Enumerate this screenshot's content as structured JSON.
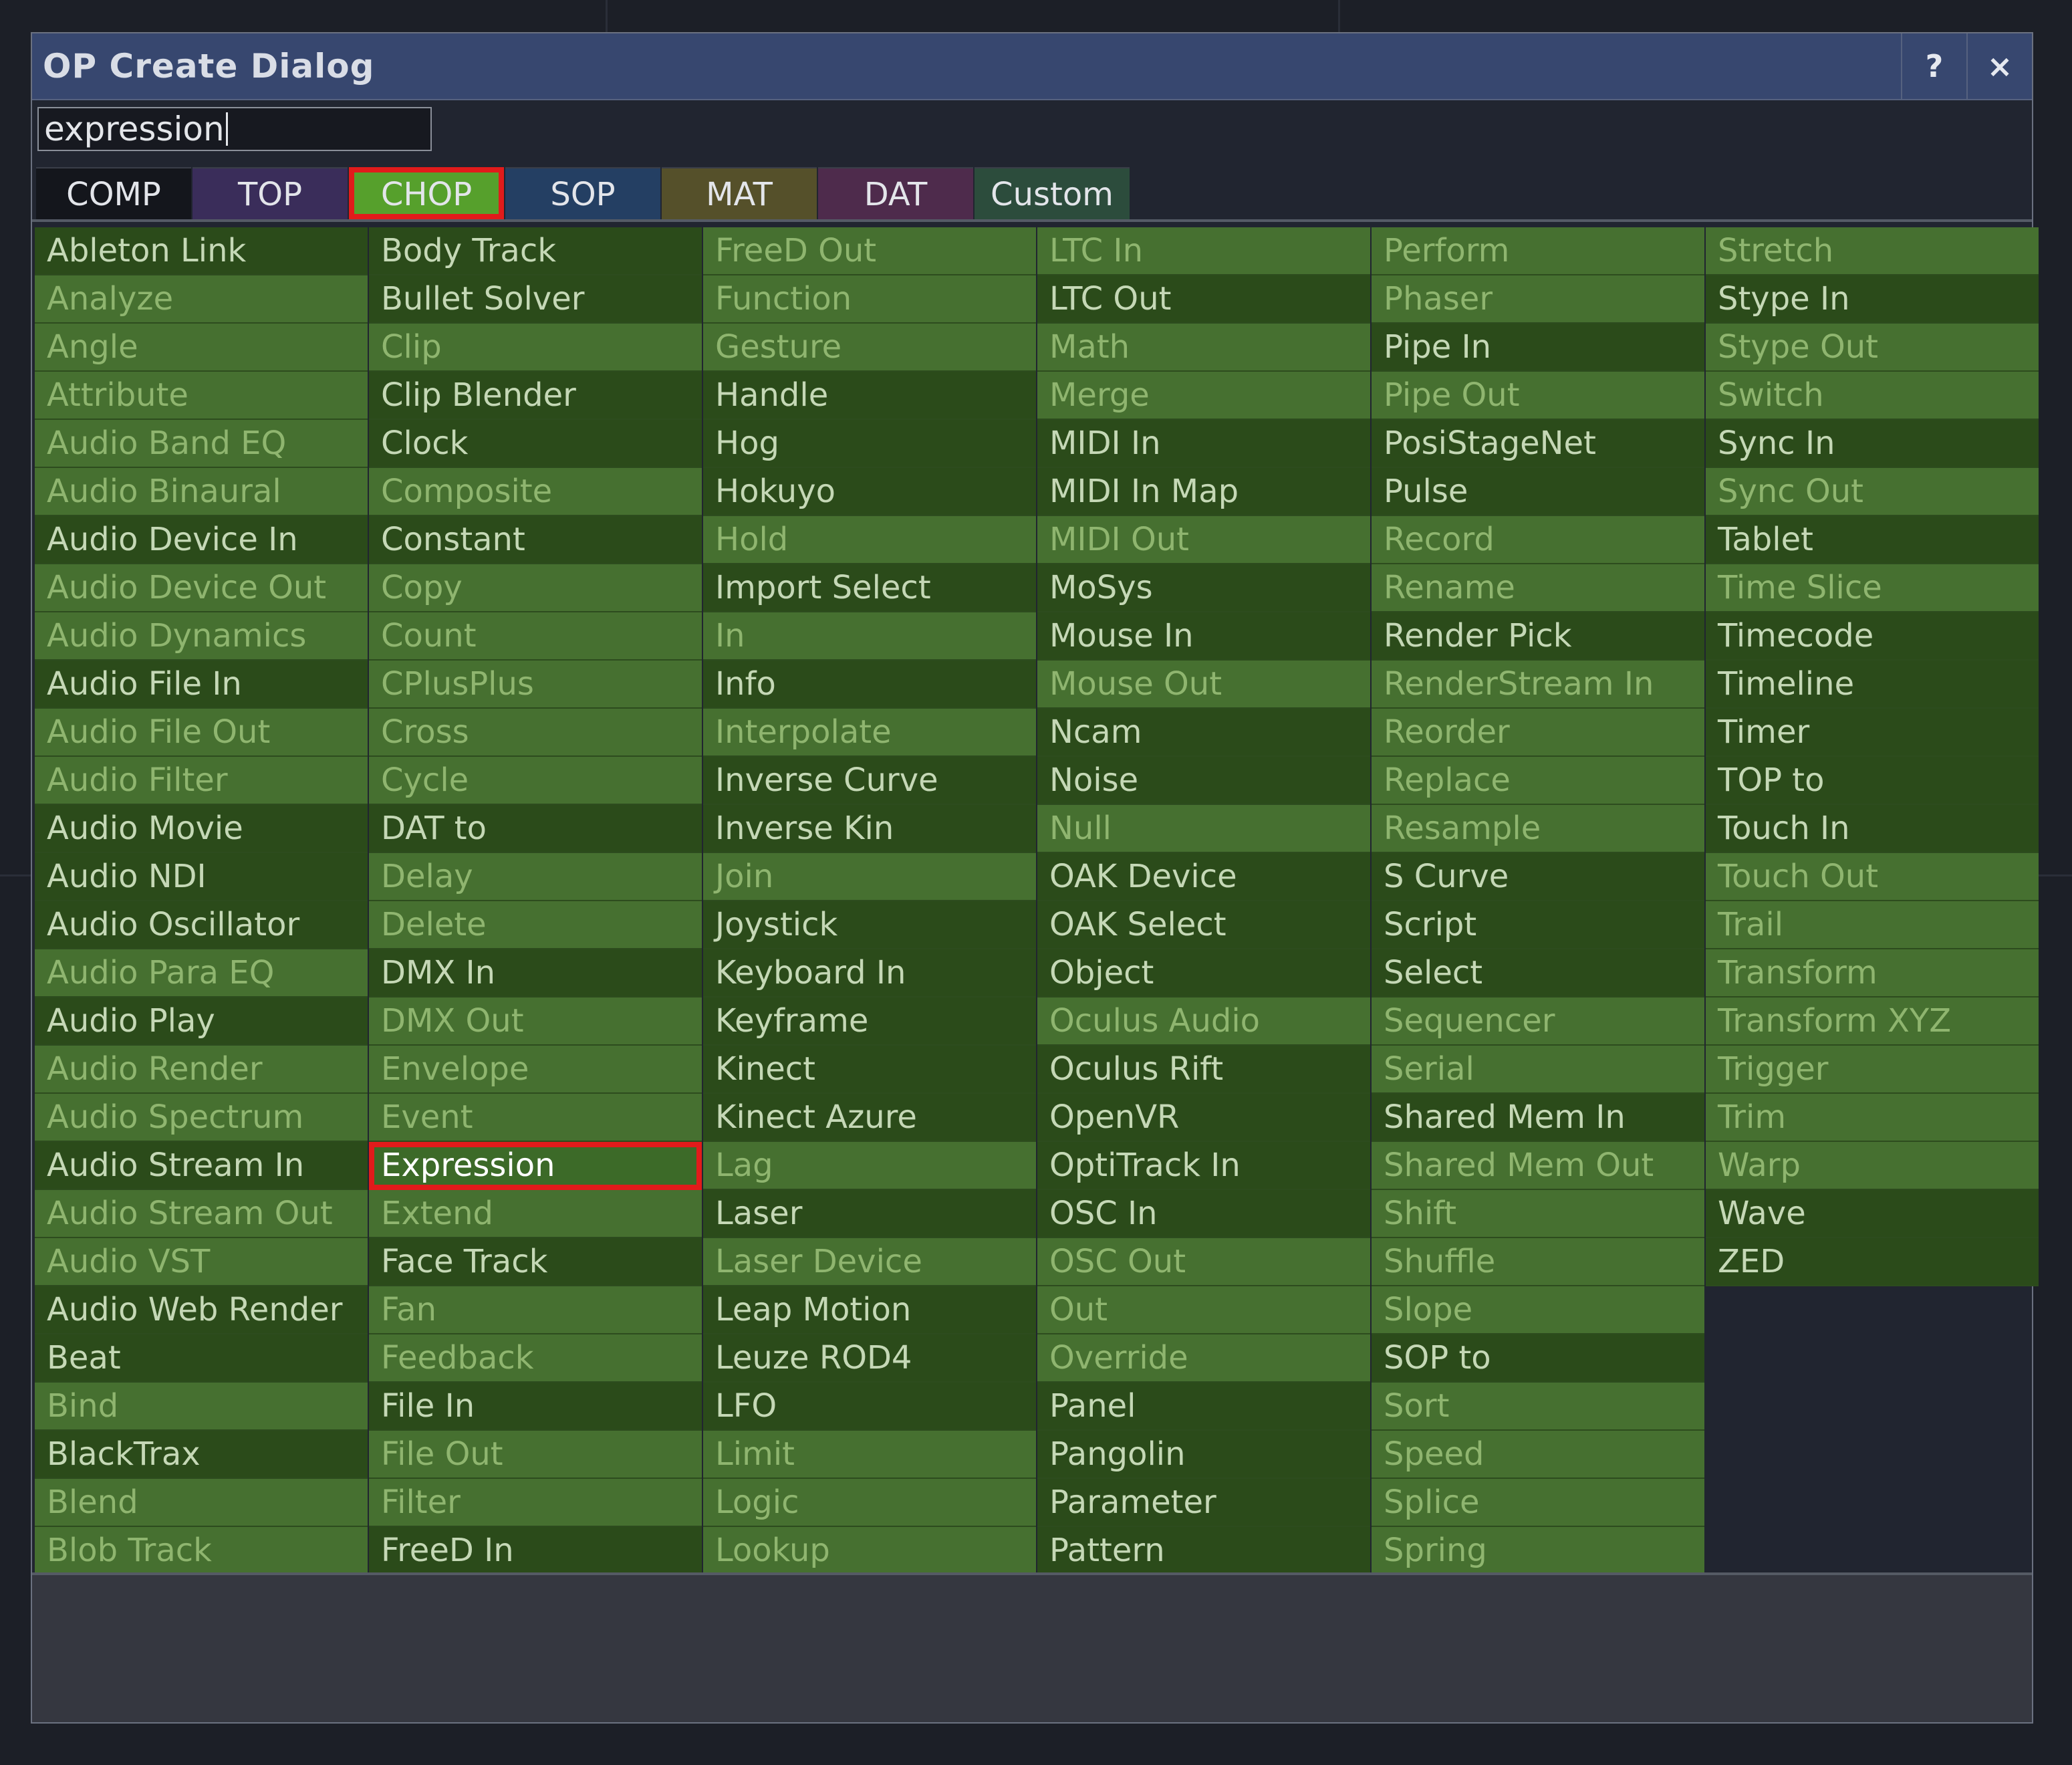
{
  "dialog": {
    "title": "OP Create Dialog",
    "help_label": "?",
    "close_label": "×"
  },
  "search": {
    "value": "expression"
  },
  "tabs": [
    {
      "label": "COMP",
      "color": "#14161c"
    },
    {
      "label": "TOP",
      "color": "#3a2d5a"
    },
    {
      "label": "CHOP",
      "color": "#56a02c",
      "selected": true
    },
    {
      "label": "SOP",
      "color": "#243f63"
    },
    {
      "label": "MAT",
      "color": "#55502a"
    },
    {
      "label": "DAT",
      "color": "#4e2b4c"
    },
    {
      "label": "Custom",
      "color": "#2c4c3c"
    }
  ],
  "operators": [
    "Ableton Link",
    "Analyze",
    "Angle",
    "Attribute",
    "Audio Band EQ",
    "Audio Binaural",
    "Audio Device In",
    "Audio Device Out",
    "Audio Dynamics",
    "Audio File In",
    "Audio File Out",
    "Audio Filter",
    "Audio Movie",
    "Audio NDI",
    "Audio Oscillator",
    "Audio Para EQ",
    "Audio Play",
    "Audio Render",
    "Audio Spectrum",
    "Audio Stream In",
    "Audio Stream Out",
    "Audio VST",
    "Audio Web Render",
    "Beat",
    "Bind",
    "BlackTrax",
    "Blend",
    "Blob Track",
    "Body Track",
    "Bullet Solver",
    "Clip",
    "Clip Blender",
    "Clock",
    "Composite",
    "Constant",
    "Copy",
    "Count",
    "CPlusPlus",
    "Cross",
    "Cycle",
    "DAT to",
    "Delay",
    "Delete",
    "DMX In",
    "DMX Out",
    "Envelope",
    "Event",
    "Expression",
    "Extend",
    "Face Track",
    "Fan",
    "Feedback",
    "File In",
    "File Out",
    "Filter",
    "FreeD In",
    "FreeD Out",
    "Function",
    "Gesture",
    "Handle",
    "Hog",
    "Hokuyo",
    "Hold",
    "Import Select",
    "In",
    "Info",
    "Interpolate",
    "Inverse Curve",
    "Inverse Kin",
    "Join",
    "Joystick",
    "Keyboard In",
    "Keyframe",
    "Kinect",
    "Kinect Azure",
    "Lag",
    "Laser",
    "Laser Device",
    "Leap Motion",
    "Leuze ROD4",
    "LFO",
    "Limit",
    "Logic",
    "Lookup",
    "LTC In",
    "LTC Out",
    "Math",
    "Merge",
    "MIDI In",
    "MIDI In Map",
    "MIDI Out",
    "MoSys",
    "Mouse In",
    "Mouse Out",
    "Ncam",
    "Noise",
    "Null",
    "OAK Device",
    "OAK Select",
    "Object",
    "Oculus Audio",
    "Oculus Rift",
    "OpenVR",
    "OptiTrack In",
    "OSC In",
    "OSC Out",
    "Out",
    "Override",
    "Panel",
    "Pangolin",
    "Parameter",
    "Pattern",
    "Perform",
    "Phaser",
    "Pipe In",
    "Pipe Out",
    "PosiStageNet",
    "Pulse",
    "Record",
    "Rename",
    "Render Pick",
    "RenderStream In",
    "Reorder",
    "Replace",
    "Resample",
    "S Curve",
    "Script",
    "Select",
    "Sequencer",
    "Serial",
    "Shared Mem In",
    "Shared Mem Out",
    "Shift",
    "Shuffle",
    "Slope",
    "SOP to",
    "Sort",
    "Speed",
    "Splice",
    "Spring",
    "Stretch",
    "Stype In",
    "Stype Out",
    "Switch",
    "Sync In",
    "Sync Out",
    "Tablet",
    "Time Slice",
    "Timecode",
    "Timeline",
    "Timer",
    "TOP to",
    "Touch In",
    "Touch Out",
    "Trail",
    "Transform",
    "Transform XYZ",
    "Trigger",
    "Trim",
    "Warp",
    "Wave",
    "ZED"
  ],
  "dark_operators": [
    "Ableton Link",
    "Audio Device In",
    "Audio File In",
    "Audio Movie",
    "Audio NDI",
    "Audio Oscillator",
    "Audio Play",
    "Audio Stream In",
    "Audio Web Render",
    "Beat",
    "BlackTrax",
    "Body Track",
    "Bullet Solver",
    "Clip Blender",
    "Clock",
    "Constant",
    "DAT to",
    "DMX In",
    "Face Track",
    "File In",
    "FreeD In",
    "Handle",
    "Hog",
    "Hokuyo",
    "Import Select",
    "Info",
    "Inverse Curve",
    "Inverse Kin",
    "Joystick",
    "Keyboard In",
    "Keyframe",
    "Kinect",
    "Kinect Azure",
    "Laser",
    "Leap Motion",
    "Leuze ROD4",
    "LFO",
    "LTC Out",
    "MIDI In",
    "MIDI In Map",
    "MoSys",
    "Mouse In",
    "Ncam",
    "Noise",
    "OAK Device",
    "OAK Select",
    "Object",
    "Oculus Rift",
    "OpenVR",
    "OptiTrack In",
    "OSC In",
    "Panel",
    "Pangolin",
    "Parameter",
    "Pattern",
    "Pipe In",
    "PosiStageNet",
    "Pulse",
    "Render Pick",
    "S Curve",
    "Script",
    "Select",
    "Shared Mem In",
    "SOP to",
    "Stype In",
    "Sync In",
    "Tablet",
    "Timecode",
    "Timeline",
    "Timer",
    "TOP to",
    "Touch In",
    "Wave",
    "ZED"
  ],
  "highlighted_operator": "Expression"
}
